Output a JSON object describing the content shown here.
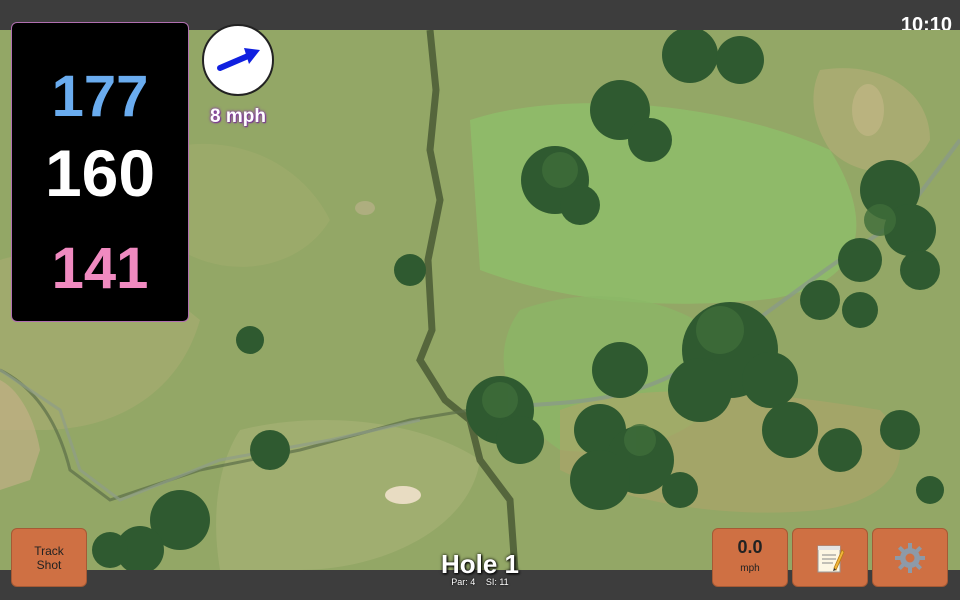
{
  "status_bar": {
    "time": "10:10"
  },
  "distances": {
    "back": "177",
    "middle": "160",
    "front": "141"
  },
  "wind": {
    "speed": "8 mph",
    "arrow_icon": "wind-direction-arrow"
  },
  "hole": {
    "title": "Hole 1",
    "par": "Par: 4",
    "stroke_index": "SI: 11"
  },
  "buttons": {
    "track_shot": "Track Shot",
    "speed_value": "0.0",
    "speed_unit": "mph",
    "notes_icon": "notepad-icon",
    "settings_icon": "gear-icon"
  },
  "colors": {
    "back_distance": "#6aacef",
    "middle_distance": "#ffffff",
    "front_distance": "#f08ac0",
    "button_bg": "#cf7043",
    "panel_bg": "#000000",
    "wind_arrow": "#1020e0"
  }
}
